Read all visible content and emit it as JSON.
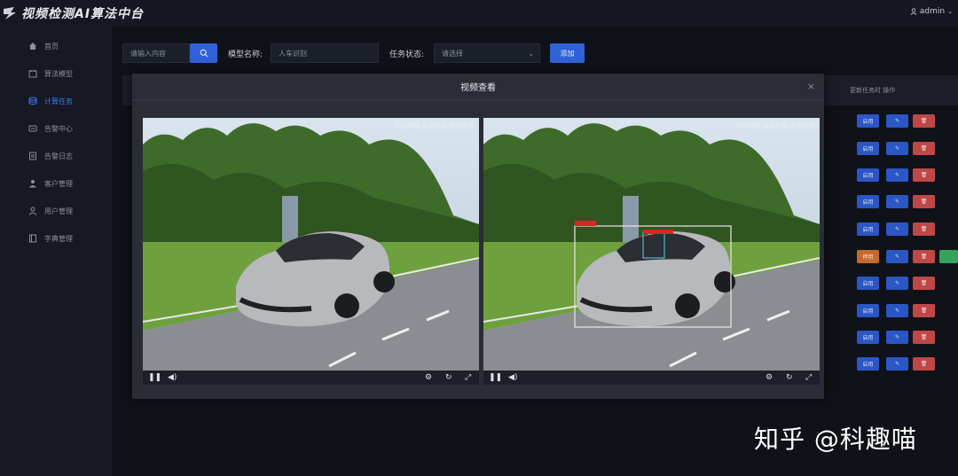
{
  "app": {
    "title": "视频检测AI算法中台",
    "user": "admin"
  },
  "sidebar": {
    "items": [
      {
        "label": "首页",
        "icon": "home-icon",
        "active": false
      },
      {
        "label": "算法模型",
        "icon": "model-icon",
        "active": false
      },
      {
        "label": "计算任务",
        "icon": "database-icon",
        "active": true
      },
      {
        "label": "告警中心",
        "icon": "alarm-icon",
        "active": false
      },
      {
        "label": "告警日志",
        "icon": "log-icon",
        "active": false
      },
      {
        "label": "客户管理",
        "icon": "customer-icon",
        "active": false
      },
      {
        "label": "用户管理",
        "icon": "user-icon",
        "active": false
      },
      {
        "label": "字典管理",
        "icon": "dictionary-icon",
        "active": false
      }
    ]
  },
  "toolbar": {
    "search_placeholder": "请输入内容",
    "model_label": "模型名称:",
    "model_placeholder": "人车识别",
    "status_label": "任务状态:",
    "status_placeholder": "请选择",
    "add_label": "添加"
  },
  "table": {
    "header_right": "更新任务时 操作",
    "rows": [
      {
        "start": "启用",
        "start_color": "blue",
        "extra": null
      },
      {
        "start": "启用",
        "start_color": "blue",
        "extra": null
      },
      {
        "start": "启用",
        "start_color": "blue",
        "extra": null
      },
      {
        "start": "启用",
        "start_color": "blue",
        "extra": null
      },
      {
        "start": "启用",
        "start_color": "blue",
        "extra": null
      },
      {
        "start": "停用",
        "start_color": "orange",
        "extra": "green"
      },
      {
        "start": "启用",
        "start_color": "blue",
        "extra": null
      },
      {
        "start": "启用",
        "start_color": "blue",
        "extra": null
      },
      {
        "start": "启用",
        "start_color": "blue",
        "extra": null
      },
      {
        "start": "启用",
        "start_color": "blue",
        "extra": null
      }
    ]
  },
  "modal": {
    "title": "视频查看",
    "close": "×",
    "videos": [
      {
        "overlay": "时间码格 安全检测 央方检测"
      },
      {
        "overlay": "时间码格 安全检测 央方检测"
      }
    ]
  },
  "watermark": "知乎 @科趣喵",
  "colors": {
    "accent": "#2f62d8",
    "danger": "#c04747",
    "warning": "#c8692c",
    "success": "#36a35a"
  }
}
